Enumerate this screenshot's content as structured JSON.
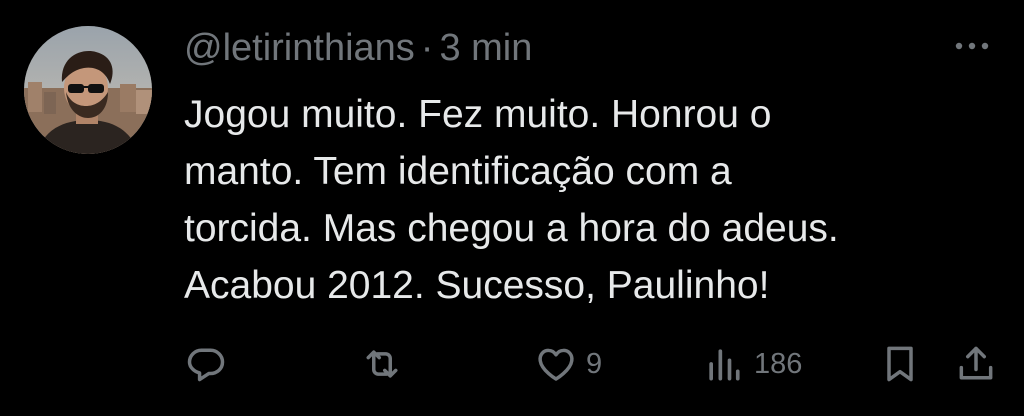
{
  "tweet": {
    "handle": "@letirinthians",
    "separator": "·",
    "time": "3 min",
    "text_lines": [
      "Jogou muito. Fez muito. Honrou o",
      "manto. Tem identificação com a",
      "torcida. Mas chegou a hora do adeus.",
      "Acabou 2012. Sucesso, Paulinho!"
    ]
  },
  "actions": {
    "reply": {
      "icon": "reply-icon"
    },
    "retweet": {
      "icon": "retweet-icon"
    },
    "like": {
      "icon": "heart-icon",
      "count": "9"
    },
    "views": {
      "icon": "views-icon",
      "count": "186"
    },
    "bookmark": {
      "icon": "bookmark-icon"
    },
    "share": {
      "icon": "share-icon"
    }
  },
  "colors": {
    "background": "#000000",
    "text": "#e7e9ea",
    "secondary": "#71767b"
  }
}
